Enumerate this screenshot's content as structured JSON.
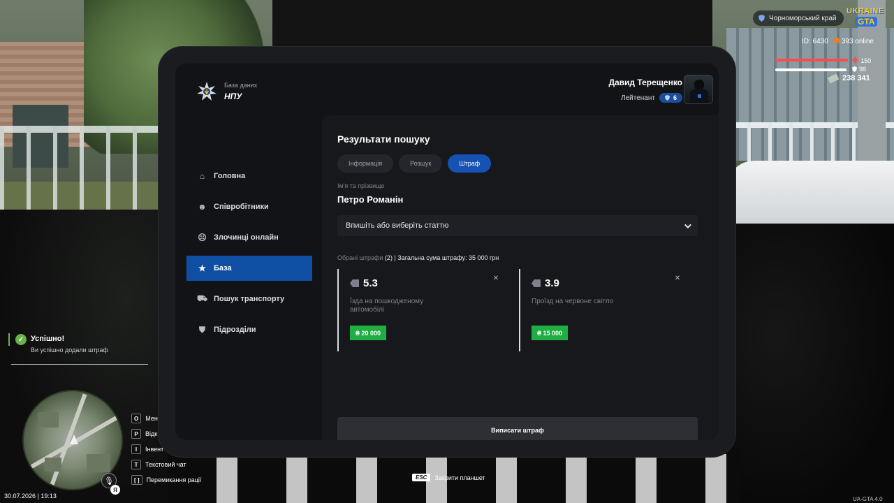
{
  "hud": {
    "region": "Чорноморський край",
    "logo_line1": "UKRAINE",
    "logo_line2": "GTA",
    "player_id": "ID: 6430",
    "online": "393 online",
    "health": "150",
    "armor": "98",
    "money": "238 341",
    "health_level": 1.0,
    "armor_level": 0.98,
    "colors": {
      "health": "#ff4b4b",
      "armor": "#ffffff"
    }
  },
  "notification": {
    "title": "Успішно!",
    "text": "Ви успішно додали штраф"
  },
  "minimap": {
    "mic_key": "Я"
  },
  "datetime": "30.07.2026 | 19:13",
  "keybinds": [
    {
      "key": "O",
      "label": "Мен"
    },
    {
      "key": "P",
      "label": "Відк"
    },
    {
      "key": "I",
      "label": "Інвент"
    },
    {
      "key": "T",
      "label": "Текстовий чат"
    },
    {
      "key": "[  ]",
      "label": "Перемикання рації"
    }
  ],
  "esc_hint": {
    "key": "ESC",
    "label": "Закрити планшет"
  },
  "version": "UA-GTA 4.0",
  "tablet": {
    "brand": {
      "subtitle": "База даних",
      "title": "НПУ"
    },
    "profile": {
      "name": "Давид Терещенко",
      "rank": "Лейтенант",
      "rank_level": "6"
    },
    "nav": [
      {
        "label": "Головна",
        "icon": "home-icon",
        "glyph": "⌂",
        "active": false
      },
      {
        "label": "Співробітники",
        "icon": "users-icon",
        "glyph": "☻",
        "active": false
      },
      {
        "label": "Злочинці онлайн",
        "icon": "criminal-icon",
        "glyph": "☹",
        "active": false
      },
      {
        "label": "База",
        "icon": "star-icon",
        "glyph": "★",
        "active": true
      },
      {
        "label": "Пошук транспорту",
        "icon": "car-icon",
        "glyph": "⛟",
        "active": false
      },
      {
        "label": "Підрозділи",
        "icon": "shield-icon",
        "glyph": "⛊",
        "active": false
      }
    ],
    "content": {
      "title": "Результати пошуку",
      "tabs": [
        {
          "label": "Інформація",
          "active": false
        },
        {
          "label": "Розшук",
          "active": false
        },
        {
          "label": "Штраф",
          "active": true
        }
      ],
      "name_label": "Ім'я та прізвище",
      "name_value": "Петро Романін",
      "article_select": "Впишіть або виберіть статтю",
      "summary_prefix": "Обрані штрафи",
      "summary_count": "(2)",
      "summary_total": "| Загальна сума штрафу: 35 000 грн",
      "fines": [
        {
          "code": "5.3",
          "description": "Їзда на пошкодженому автомобілі",
          "amount": "₴ 20 000"
        },
        {
          "code": "3.9",
          "description": "Проїзд на червоне світло",
          "amount": "₴ 15 000"
        }
      ],
      "issue_button": "Виписати штраф"
    },
    "colors": {
      "accent": "#0e4ea3",
      "amount": "#1fae41"
    }
  }
}
